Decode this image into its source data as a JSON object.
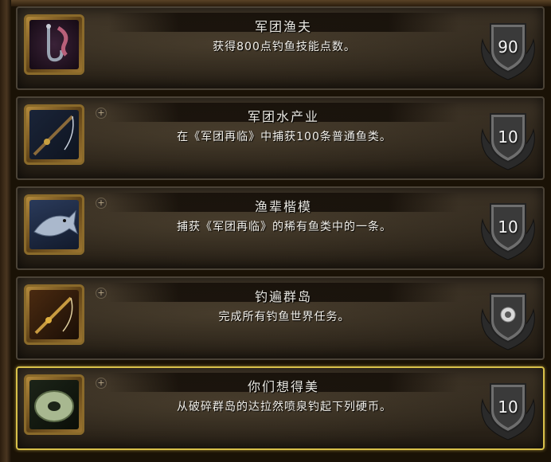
{
  "achievements": [
    {
      "title": "军团渔夫",
      "description": "获得800点钓鱼技能点数。",
      "points": "90",
      "expandable": false,
      "selected": false,
      "icon": "fishing-hook-icon",
      "points_icon": "shield-icon"
    },
    {
      "title": "军团水产业",
      "description": "在《军团再临》中捕获100条普通鱼类。",
      "points": "10",
      "expandable": true,
      "selected": false,
      "icon": "fishing-pole-icon",
      "points_icon": "shield-icon"
    },
    {
      "title": "渔辈楷模",
      "description": "捕获《军团再临》的稀有鱼类中的一条。",
      "points": "10",
      "expandable": true,
      "selected": false,
      "icon": "rare-fish-icon",
      "points_icon": "shield-icon"
    },
    {
      "title": "钓遍群岛",
      "description": "完成所有钓鱼世界任务。",
      "points": "",
      "expandable": true,
      "selected": false,
      "icon": "fishing-pole-icon",
      "points_icon": "feat-of-strength-shield-icon"
    },
    {
      "title": "你们想得美",
      "description": "从破碎群岛的达拉然喷泉钓起下列硬币。",
      "points": "10",
      "expandable": true,
      "selected": true,
      "icon": "coin-icon",
      "points_icon": "shield-icon"
    }
  ],
  "colors": {
    "selected_border": "#d8c04a",
    "title_text": "#e8e6e0",
    "desc_text": "#f2f0ea"
  }
}
